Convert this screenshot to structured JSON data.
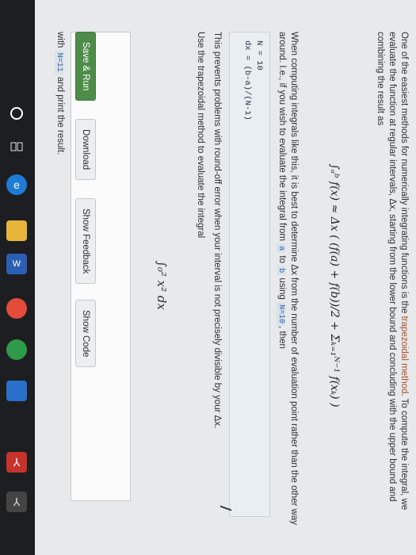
{
  "taskbar": {
    "icons": [
      "circle-start-icon",
      "task-view-icon",
      "edge-icon",
      "file-explorer-icon",
      "word-icon",
      "chrome-icon",
      "chrome-icon",
      "taskbar-blue-app-icon",
      "acrobat-icon",
      "acrobat-icon"
    ]
  },
  "problem": {
    "intro_part1": "One of the easiest methods for numerically integrating functions is the ",
    "intro_highlight": "trapezoidal method",
    "intro_part2": ". To compute the integral, we evaluate the function at regular intervals, Δx, starting from the lower bound and concluding with the upper bound and combining the result as",
    "formula": "∫ₐᵇ f(x) ≈ Δx ( (f(a) + f(b))/2 + Σₖ₌₁ᴺ⁻¹ f(xₖ) )",
    "para2_part1": "When computing integrals like this, it is best to determine Δx from the number of evaluation point rather than the other way around. I.e., if you wish to evaluate the integral from ",
    "para2_a": "a",
    "para2_to": " to ",
    "para2_b": "b",
    "para2_using": " using ",
    "para2_n": "N=10",
    "para2_end": ", then",
    "code_lines": [
      "N = 10",
      "dx = (b-a)/(N-1)"
    ],
    "para3": "This prevents problems with round-off error when your interval is not precisely divisible by your Δx.",
    "para4": "Use the trapezoidal method to evaluate the integral",
    "integral": "∫₀² x² dx",
    "with_prefix": "with ",
    "with_n": "N=11",
    "with_suffix": " and print the result."
  },
  "buttons": {
    "save_run": "Save & Run",
    "download": "Download",
    "show_feedback": "Show Feedback",
    "show_code": "Show Code"
  }
}
